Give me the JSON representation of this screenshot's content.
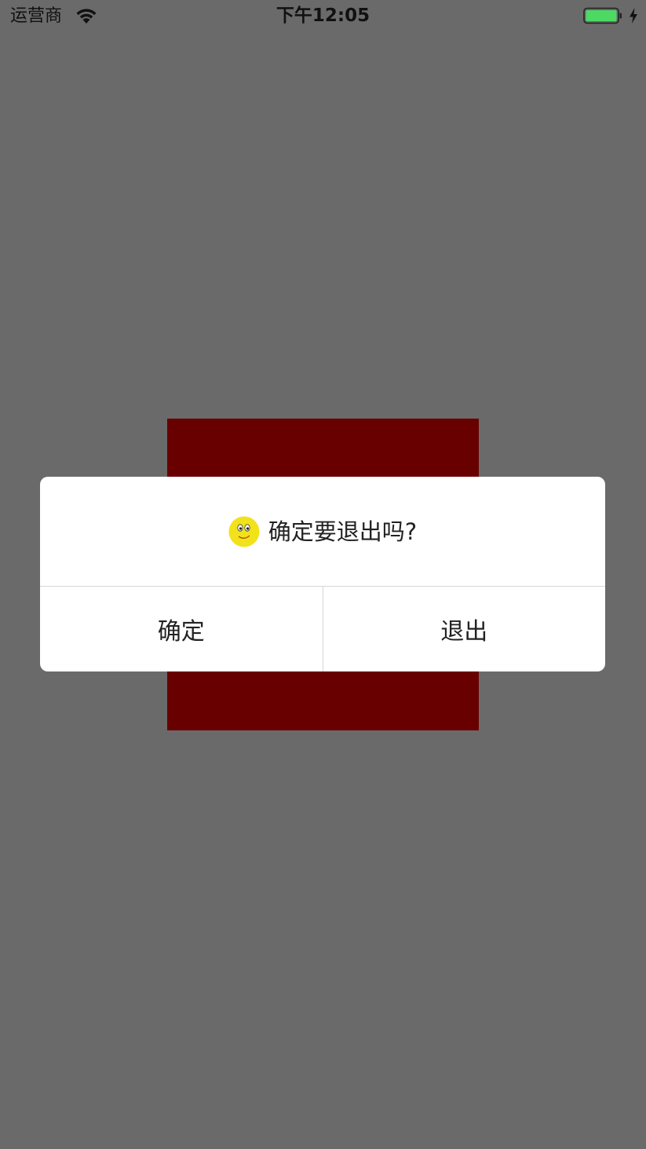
{
  "status_bar": {
    "carrier": "运营商",
    "time": "下午12:05",
    "wifi_icon": "wifi-icon",
    "battery_icon": "battery-icon",
    "charging_icon": "charging-bolt-icon",
    "battery_level": 1.0
  },
  "colors": {
    "background": "#6a6a6a",
    "panel": "#690000",
    "dialog": "#ffffff",
    "battery_fill": "#4cd964",
    "smiley": "#f2e21c"
  },
  "dialog": {
    "icon": "smiley-face-icon",
    "message": "确定要退出吗?",
    "confirm_label": "确定",
    "exit_label": "退出"
  }
}
